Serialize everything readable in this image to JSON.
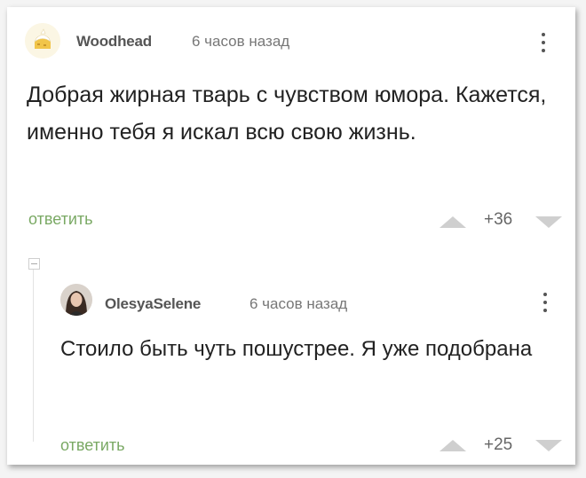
{
  "comments": [
    {
      "author": "Woodhead",
      "time": "6 часов назад",
      "text": "Добрая жирная тварь с чувством юмора. Кажется, именно тебя я искал всю свою жизнь.",
      "reply_label": "ответить",
      "score": "+36",
      "avatar_icon": "cake-avatar-icon"
    },
    {
      "author": "OlesyaSelene",
      "time": "6 часов назад",
      "text": "Стоило быть чуть пошустрее. Я уже подобрана",
      "reply_label": "ответить",
      "score": "+25",
      "avatar_icon": "user-photo-avatar"
    }
  ],
  "colors": {
    "reply": "#7aa964",
    "vote_arrow": "#cfcfcf",
    "author": "#555555"
  }
}
